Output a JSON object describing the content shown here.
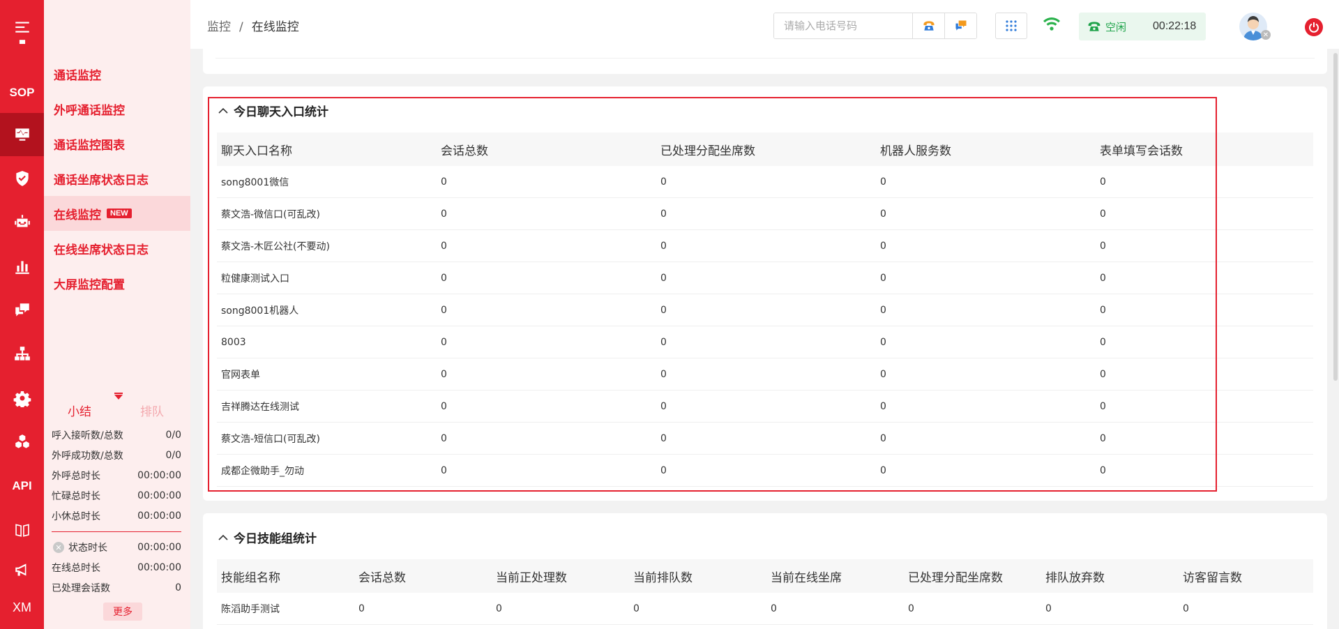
{
  "rail": {
    "sop_label": "SOP",
    "api_label": "API",
    "xm_label": "XM"
  },
  "submenu": {
    "items": [
      {
        "label": "通话监控"
      },
      {
        "label": "外呼通话监控"
      },
      {
        "label": "通话监控图表"
      },
      {
        "label": "通话坐席状态日志"
      },
      {
        "label": "在线监控",
        "badge": "NEW"
      },
      {
        "label": "在线坐席状态日志"
      },
      {
        "label": "大屏监控配置"
      }
    ]
  },
  "summary": {
    "tab_summary": "小结",
    "tab_queue": "排队",
    "stats_a": [
      {
        "label": "呼入接听数/总数",
        "value": "0/0"
      },
      {
        "label": "外呼成功数/总数",
        "value": "0/0"
      },
      {
        "label": "外呼总时长",
        "value": "00:00:00"
      },
      {
        "label": "忙碌总时长",
        "value": "00:00:00"
      },
      {
        "label": "小休总时长",
        "value": "00:00:00"
      }
    ],
    "stats_b": [
      {
        "label": "状态时长",
        "value": "00:00:00"
      },
      {
        "label": "在线总时长",
        "value": "00:00:00"
      },
      {
        "label": "已处理会话数",
        "value": "0"
      }
    ],
    "more_label": "更多"
  },
  "header": {
    "breadcrumb_root": "监控",
    "breadcrumb_sep": "/",
    "breadcrumb_current": "在线监控",
    "phone_placeholder": "请输入电话号码",
    "status_label": "空闲",
    "timer": "00:22:18"
  },
  "chat_entry": {
    "title": "今日聊天入口统计",
    "columns": [
      "聊天入口名称",
      "会话总数",
      "已处理分配坐席数",
      "机器人服务数",
      "表单填写会话数"
    ],
    "rows": [
      [
        "song8001微信",
        "0",
        "0",
        "0",
        "0"
      ],
      [
        "蔡文浩-微信口(可乱改)",
        "0",
        "0",
        "0",
        "0"
      ],
      [
        "蔡文浩-木匠公社(不要动)",
        "0",
        "0",
        "0",
        "0"
      ],
      [
        "粒健康测试入口",
        "0",
        "0",
        "0",
        "0"
      ],
      [
        "song8001机器人",
        "0",
        "0",
        "0",
        "0"
      ],
      [
        "8003",
        "0",
        "0",
        "0",
        "0"
      ],
      [
        "官网表单",
        "0",
        "0",
        "0",
        "0"
      ],
      [
        "吉祥腾达在线测试",
        "0",
        "0",
        "0",
        "0"
      ],
      [
        "蔡文浩-短信口(可乱改)",
        "0",
        "0",
        "0",
        "0"
      ],
      [
        "成都企微助手_勿动",
        "0",
        "0",
        "0",
        "0"
      ]
    ]
  },
  "skill_group": {
    "title": "今日技能组统计",
    "columns": [
      "技能组名称",
      "会话总数",
      "当前正处理数",
      "当前排队数",
      "当前在线坐席",
      "已处理分配坐席数",
      "排队放弃数",
      "访客留言数"
    ],
    "rows": [
      [
        "陈滔助手测试",
        "0",
        "0",
        "0",
        "0",
        "0",
        "0",
        "0"
      ]
    ]
  },
  "colors": {
    "brand": "#e5202f",
    "brand_dark": "#b3121e",
    "submenu_bg": "#fdeeee",
    "idle_green": "#1ea34a"
  }
}
